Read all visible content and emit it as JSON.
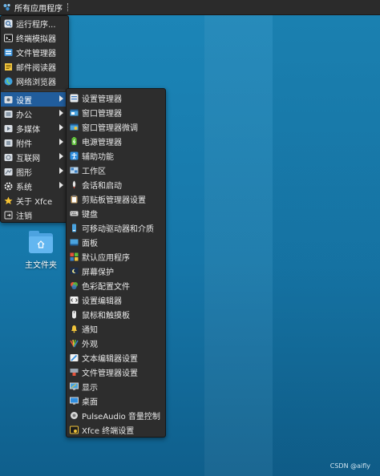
{
  "panel": {
    "appmenu_label": "所有应用程序",
    "appmenu_icon": "xfce-apps-icon"
  },
  "main_menu": {
    "items": [
      {
        "label": "运行程序...",
        "icon": "search-run-icon"
      },
      {
        "label": "终端模拟器",
        "icon": "terminal-icon"
      },
      {
        "label": "文件管理器",
        "icon": "file-manager-icon"
      },
      {
        "label": "邮件阅读器",
        "icon": "mail-icon"
      },
      {
        "label": "网络浏览器",
        "icon": "globe-icon"
      },
      {
        "label": "设置",
        "icon": "settings-icon",
        "submenu": true,
        "active": true
      },
      {
        "label": "办公",
        "icon": "office-icon",
        "submenu": true
      },
      {
        "label": "多媒体",
        "icon": "multimedia-icon",
        "submenu": true
      },
      {
        "label": "附件",
        "icon": "accessories-icon",
        "submenu": true
      },
      {
        "label": "互联网",
        "icon": "internet-icon",
        "submenu": true
      },
      {
        "label": "图形",
        "icon": "graphics-icon",
        "submenu": true
      },
      {
        "label": "系统",
        "icon": "gear-icon",
        "submenu": true
      },
      {
        "label": "关于 Xfce",
        "icon": "star-icon"
      },
      {
        "label": "注销",
        "icon": "logout-icon"
      }
    ]
  },
  "settings_menu": {
    "items": [
      {
        "label": "设置管理器",
        "icon": "settings-manager-icon"
      },
      {
        "label": "窗口管理器",
        "icon": "window-manager-icon"
      },
      {
        "label": "窗口管理器微调",
        "icon": "window-tweaks-icon"
      },
      {
        "label": "电源管理器",
        "icon": "power-icon"
      },
      {
        "label": "辅助功能",
        "icon": "accessibility-icon"
      },
      {
        "label": "工作区",
        "icon": "workspaces-icon"
      },
      {
        "label": "会话和启动",
        "icon": "session-icon"
      },
      {
        "label": "剪贴板管理器设置",
        "icon": "clipboard-icon"
      },
      {
        "label": "键盘",
        "icon": "keyboard-icon"
      },
      {
        "label": "可移动驱动器和介质",
        "icon": "removable-drive-icon"
      },
      {
        "label": "面板",
        "icon": "panel-icon"
      },
      {
        "label": "默认应用程序",
        "icon": "default-apps-icon"
      },
      {
        "label": "屏幕保护",
        "icon": "screensaver-icon"
      },
      {
        "label": "色彩配置文件",
        "icon": "color-profile-icon"
      },
      {
        "label": "设置编辑器",
        "icon": "settings-editor-icon"
      },
      {
        "label": "鼠标和触摸板",
        "icon": "mouse-icon"
      },
      {
        "label": "通知",
        "icon": "bell-icon"
      },
      {
        "label": "外观",
        "icon": "appearance-icon"
      },
      {
        "label": "文本编辑器设置",
        "icon": "text-editor-icon"
      },
      {
        "label": "文件管理器设置",
        "icon": "file-manager-settings-icon"
      },
      {
        "label": "显示",
        "icon": "display-icon"
      },
      {
        "label": "桌面",
        "icon": "desktop-icon"
      },
      {
        "label": "PulseAudio 音量控制",
        "icon": "pulseaudio-icon"
      },
      {
        "label": "Xfce 终端设置",
        "icon": "terminal-settings-icon"
      }
    ]
  },
  "desktop": {
    "home_folder_label": "主文件夹"
  },
  "watermark": "CSDN @aifly",
  "colors": {
    "menu_bg": "#2d2d2d",
    "highlight": "#215d9c",
    "panel_bg": "#2b2b2b",
    "desktop": "#1677a9"
  }
}
